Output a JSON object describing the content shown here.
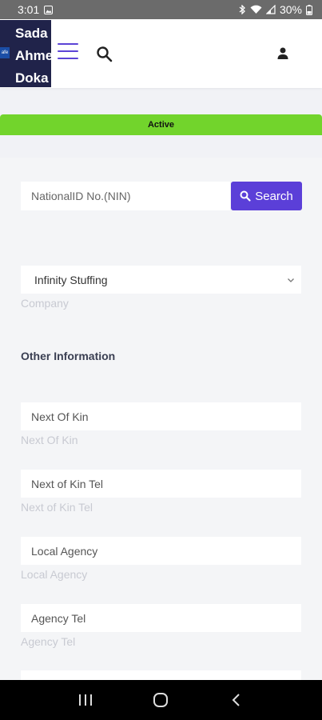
{
  "status_bar": {
    "time": "3:01",
    "battery": "30%"
  },
  "header": {
    "brand_lines": [
      "Sada",
      "Ahme",
      "Doka"
    ],
    "logo_text": "afe",
    "icons": [
      "menu-icon",
      "search-icon",
      "user-icon"
    ]
  },
  "status_banner": {
    "label": "Active"
  },
  "nin_search": {
    "placeholder": "NationalID No.(NIN)",
    "button_label": "Search"
  },
  "company": {
    "selected": "Infinity Stuffing",
    "label": "Company"
  },
  "other_information": {
    "title": "Other Information",
    "fields": [
      {
        "placeholder": "Next Of Kin",
        "label": "Next Of Kin"
      },
      {
        "placeholder": "Next of Kin Tel",
        "label": "Next of Kin Tel"
      },
      {
        "placeholder": "Local Agency",
        "label": "Local Agency"
      },
      {
        "placeholder": "Agency Tel",
        "label": "Agency Tel"
      }
    ]
  },
  "colors": {
    "brand_bg": "#20234a",
    "accent": "#5b3fd8",
    "active_green": "#72d42c"
  }
}
